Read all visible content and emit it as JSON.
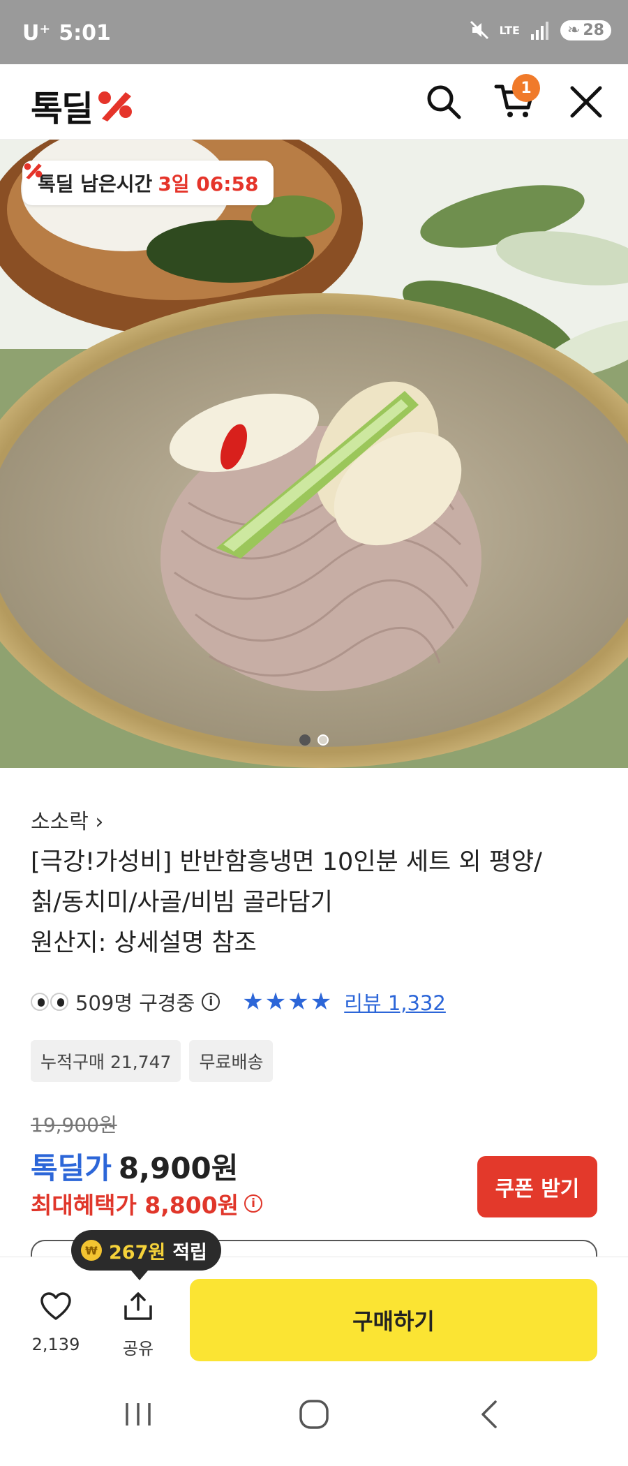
{
  "status_bar": {
    "carrier": "U⁺",
    "time": "5:01",
    "network": "LTE",
    "battery": "28"
  },
  "header": {
    "logo_text": "톡딜",
    "logo_symbol": "%",
    "cart_count": "1",
    "icons": [
      "search-icon",
      "cart-icon",
      "close-icon"
    ],
    "brand_color": "#e5342a"
  },
  "hero": {
    "timer_label": "톡딜 남은시간",
    "timer_value": "3일 06:58",
    "total_slides": 2,
    "active_slide": 1
  },
  "product": {
    "seller": "소소락",
    "seller_chevron": "›",
    "title_lines": [
      "[극강!가성비] 반반함흥냉면 10인분 세트 외 평양/",
      "칡/동치미/사골/비빔 골라담기",
      "원산지: 상세설명 참조"
    ],
    "viewers": "509명 구경중",
    "rating_stars": 4,
    "review_label": "리뷰 1,332",
    "tags": [
      "누적구매 21,747",
      "무료배송"
    ],
    "original_price": "19,900원",
    "deal_label": "톡딜가",
    "deal_price": "8,900원",
    "max_benefit_label": "최대혜택가 8,800원",
    "coupon_button": "쿠폰 받기"
  },
  "bottom_bar": {
    "reward_amount": "267원",
    "reward_suffix": "적립",
    "like_count": "2,139",
    "share_label": "공유",
    "buy_button": "구매하기"
  },
  "colors": {
    "deal_blue": "#2c66d8",
    "max_red": "#e0362a",
    "buy_yellow": "#fbe433",
    "coupon_red": "#e3392b"
  }
}
